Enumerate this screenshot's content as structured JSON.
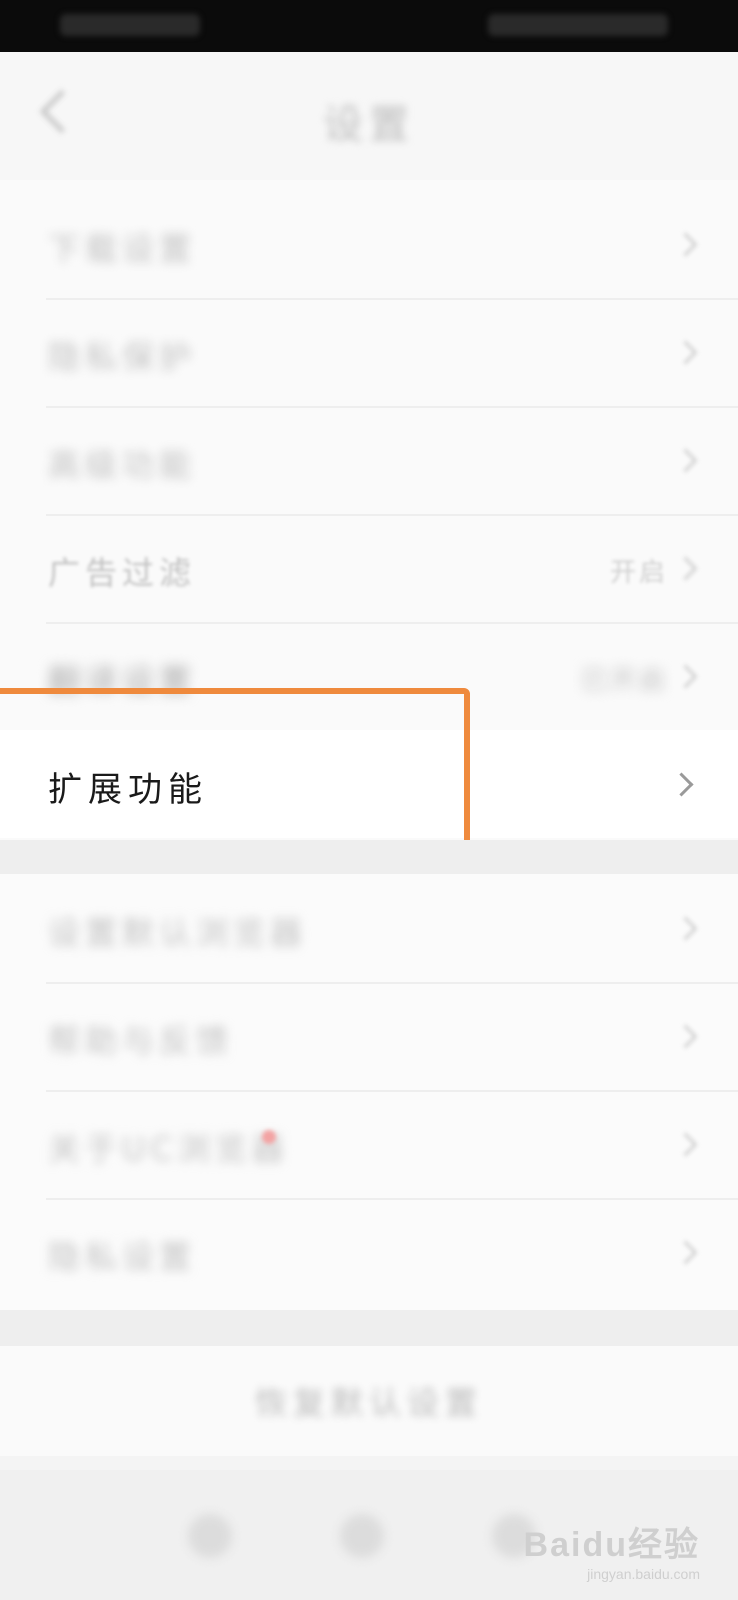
{
  "header": {
    "title": "设置"
  },
  "settings": [
    {
      "label": "下载设置",
      "value": ""
    },
    {
      "label": "隐私保护",
      "value": ""
    },
    {
      "label": "高级功能",
      "value": ""
    },
    {
      "label": "广告过滤",
      "value": "开启"
    },
    {
      "label": "翻译设置",
      "value": "已开启"
    }
  ],
  "extension": {
    "label": "扩展功能"
  },
  "settings2": [
    {
      "label": "设置默认浏览器"
    },
    {
      "label": "帮助与反馈"
    },
    {
      "label": "关于UC浏览器"
    },
    {
      "label": "隐私设置"
    }
  ],
  "reset": {
    "label": "恢复默认设置"
  },
  "watermark": {
    "brand": "Baidu经验",
    "site": "jingyan.baidu.com"
  },
  "colors": {
    "highlight": "#ef8a3d"
  }
}
